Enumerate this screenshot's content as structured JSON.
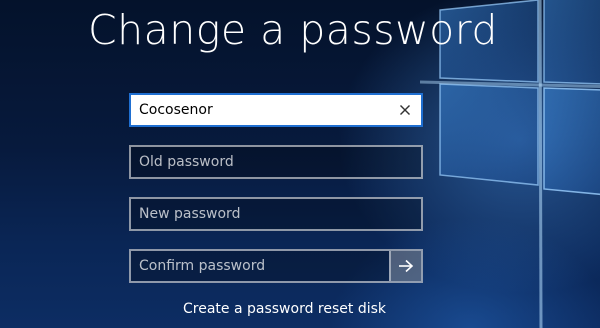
{
  "screen": {
    "title": "Change a password"
  },
  "form": {
    "username": {
      "value": "Cocosenor",
      "placeholder": ""
    },
    "old_password": {
      "placeholder": "Old password"
    },
    "new_password": {
      "placeholder": "New password"
    },
    "confirm_password": {
      "placeholder": "Confirm password"
    },
    "clear_icon": "close-icon",
    "submit_icon": "arrow-right-icon"
  },
  "links": {
    "reset_disk": "Create a password reset disk"
  },
  "colors": {
    "background_dark": "#04122b",
    "background_light": "#0d2d63",
    "focus_border": "#1f6fd1",
    "text": "#ffffff"
  }
}
